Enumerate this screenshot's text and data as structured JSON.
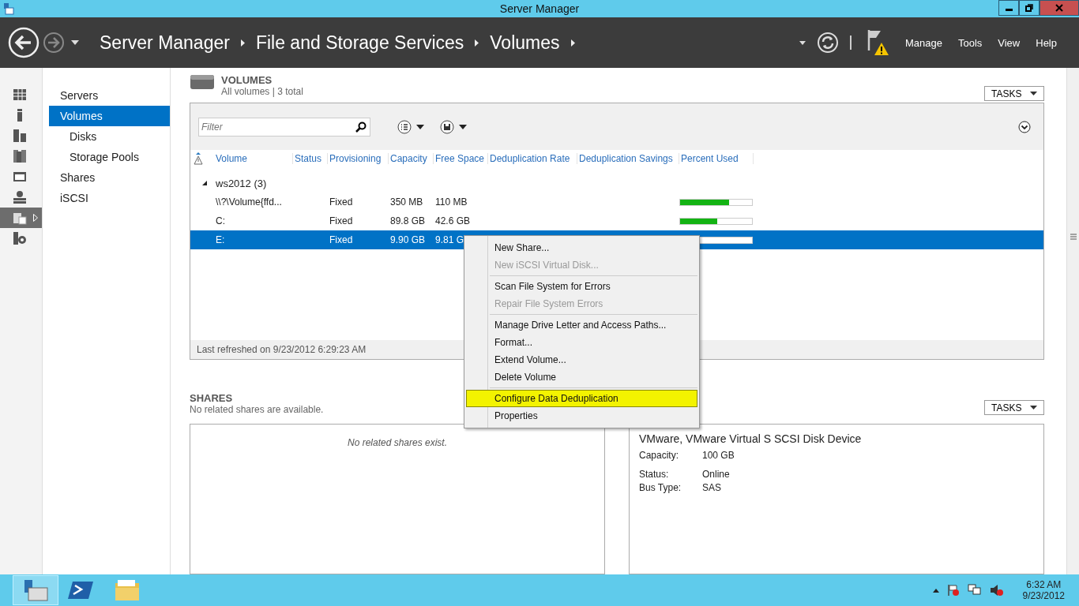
{
  "window": {
    "title": "Server Manager"
  },
  "header": {
    "breadcrumbs": [
      "Server Manager",
      "File and Storage Services",
      "Volumes"
    ],
    "menu": [
      "Manage",
      "Tools",
      "View",
      "Help"
    ]
  },
  "icon_strip": [
    {
      "selected": false
    },
    {
      "selected": false
    },
    {
      "selected": false
    },
    {
      "selected": false
    },
    {
      "selected": false
    },
    {
      "selected": false
    },
    {
      "selected": true
    },
    {
      "selected": false
    }
  ],
  "nav": {
    "items": [
      {
        "label": "Servers",
        "selected": false
      },
      {
        "label": "Volumes",
        "selected": true,
        "children": [
          {
            "label": "Disks",
            "selected": false
          },
          {
            "label": "Storage Pools",
            "selected": false
          }
        ]
      },
      {
        "label": "Shares",
        "selected": false
      },
      {
        "label": "iSCSI",
        "selected": false
      }
    ]
  },
  "volumes": {
    "title": "VOLUMES",
    "subtitle": "All volumes | 3 total",
    "tasks": "TASKS",
    "filter": {
      "placeholder": "Filter"
    },
    "columns": [
      "Volume",
      "Status",
      "Provisioning",
      "Capacity",
      "Free Space",
      "Deduplication Rate",
      "Deduplication Savings",
      "Percent Used"
    ],
    "group": {
      "label": "ws2012 (3)",
      "expanded": true
    },
    "rows": [
      {
        "volume": "\\\\?\\Volume{ffd...",
        "provisioning": "Fixed",
        "capacity": "350 MB",
        "free_space": "110 MB",
        "level": 0.68,
        "selected": false
      },
      {
        "volume": "C:",
        "provisioning": "Fixed",
        "capacity": "89.8 GB",
        "free_space": "42.6 GB",
        "level": 0.52,
        "selected": false
      },
      {
        "volume": "E:",
        "provisioning": "Fixed",
        "capacity": "9.90 GB",
        "free_space": "9.81 G",
        "level": 0.01,
        "selected": true
      }
    ],
    "footer": "Last refreshed on 9/23/2012 6:29:23 AM"
  },
  "context_menu": {
    "groups": [
      [
        {
          "label": "New Share...",
          "disabled": false,
          "selected": false
        },
        {
          "label": "New iSCSI Virtual Disk...",
          "disabled": true,
          "selected": false
        }
      ],
      [
        {
          "label": "Scan File System for Errors",
          "disabled": false,
          "selected": false
        },
        {
          "label": "Repair File System Errors",
          "disabled": true,
          "selected": false
        }
      ],
      [
        {
          "label": "Manage Drive Letter and Access Paths...",
          "disabled": false,
          "selected": false
        },
        {
          "label": "Format...",
          "disabled": false,
          "selected": false
        },
        {
          "label": "Extend Volume...",
          "disabled": false,
          "selected": false
        },
        {
          "label": "Delete Volume",
          "disabled": false,
          "selected": false
        }
      ],
      [
        {
          "label": "Configure Data Deduplication",
          "disabled": false,
          "selected": true
        },
        {
          "label": "Properties",
          "disabled": false,
          "selected": false
        }
      ]
    ]
  },
  "shares": {
    "title": "SHARES",
    "subtitle": "No related shares are available.",
    "empty": "No related shares exist.",
    "tasks": "TASKS"
  },
  "disk": {
    "title": "VMware, VMware Virtual S SCSI Disk Device",
    "properties": [
      {
        "label": "Capacity:",
        "value": "100 GB"
      },
      {
        "label": "Status:",
        "value": "Online"
      },
      {
        "label": "Bus Type:",
        "value": "SAS"
      }
    ]
  },
  "taskbar": {
    "apps": [
      {
        "selected": true
      },
      {
        "selected": false
      },
      {
        "selected": false
      }
    ],
    "time": "6:32 AM",
    "date": "9/23/2012"
  }
}
